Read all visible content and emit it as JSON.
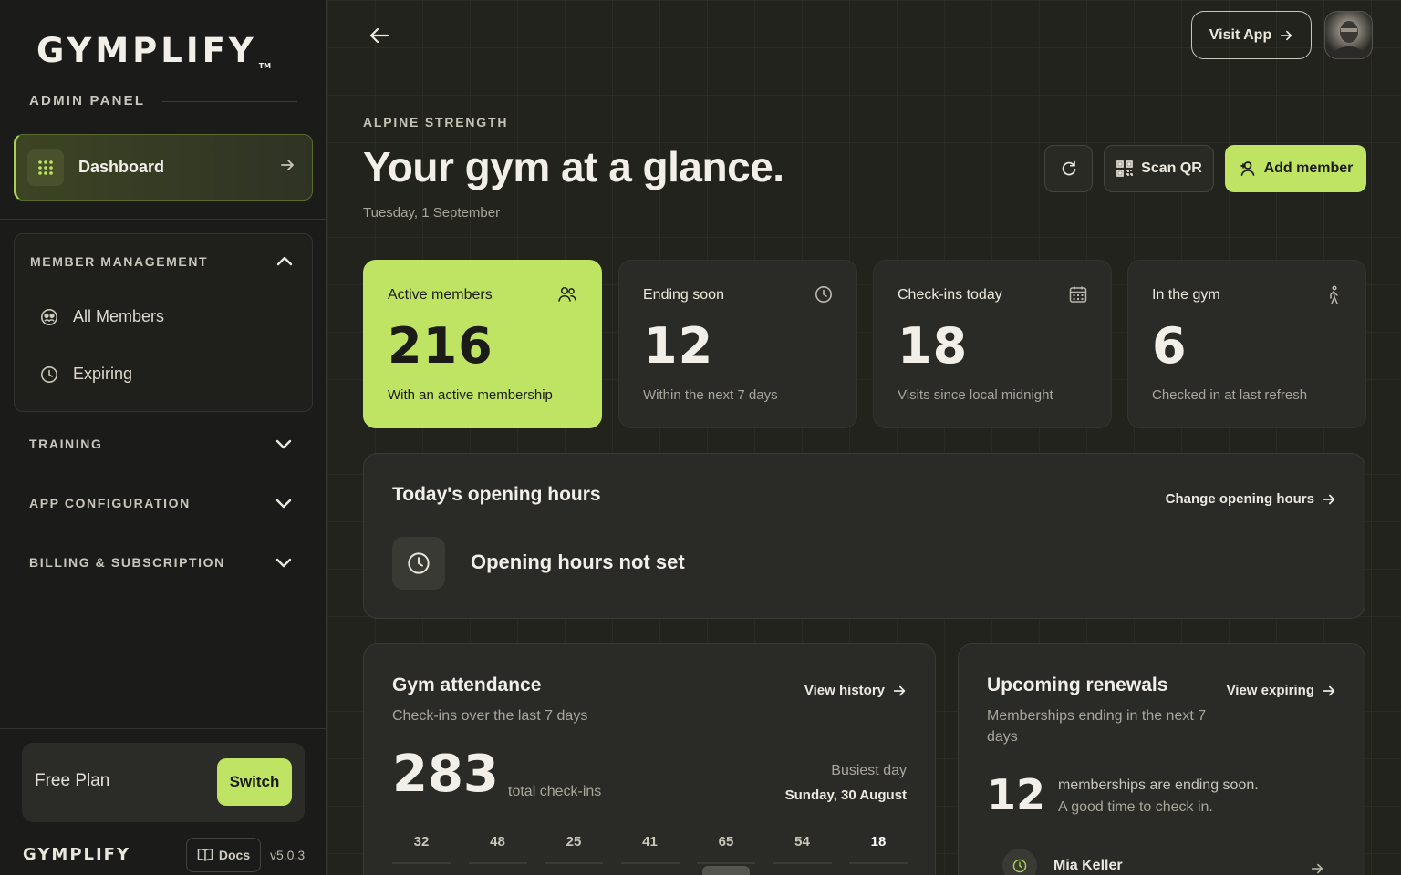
{
  "sidebar": {
    "brand": "GYMPLIFY",
    "brand_mark": "TM",
    "admin_label": "ADMIN PANEL",
    "dashboard_label": "Dashboard",
    "groups": [
      {
        "title": "MEMBER MANAGEMENT",
        "expanded": true,
        "items": [
          {
            "label": "All Members",
            "icon": "members-icon"
          },
          {
            "label": "Expiring",
            "icon": "clock-icon"
          }
        ]
      },
      {
        "title": "TRAINING",
        "expanded": false
      },
      {
        "title": "APP CONFIGURATION",
        "expanded": false
      },
      {
        "title": "BILLING & SUBSCRIPTION",
        "expanded": false
      }
    ],
    "plan": {
      "name": "Free Plan",
      "switch_label": "Switch"
    },
    "footer": {
      "brand": "GYMPLIFY",
      "docs_label": "Docs",
      "version": "v5.0.3"
    }
  },
  "header": {
    "visit_app_label": "Visit App"
  },
  "page": {
    "eyebrow": "ALPINE STRENGTH",
    "title": "Your gym at a glance.",
    "date": "Tuesday, 1 September",
    "actions": {
      "scan_label": "Scan QR",
      "add_label": "Add member"
    }
  },
  "stats": [
    {
      "label": "Active members",
      "value": "216",
      "sub": "With an active membership",
      "icon": "people-icon",
      "highlight": true
    },
    {
      "label": "Ending soon",
      "value": "12",
      "sub": "Within the next 7 days",
      "icon": "clock-icon"
    },
    {
      "label": "Check-ins today",
      "value": "18",
      "sub": "Visits since local midnight",
      "icon": "calendar-icon"
    },
    {
      "label": "In the gym",
      "value": "6",
      "sub": "Checked in at last refresh",
      "icon": "walking-icon"
    }
  ],
  "opening_hours": {
    "title": "Today's opening hours",
    "link": "Change opening hours",
    "status": "Opening hours not set"
  },
  "attendance": {
    "title": "Gym attendance",
    "link": "View history",
    "subtitle": "Check-ins over the last 7 days",
    "total": "283",
    "total_label": "total check-ins",
    "busiest_label": "Busiest day",
    "busiest_value": "Sunday, 30 August",
    "days": [
      32,
      48,
      25,
      41,
      65,
      54,
      18
    ],
    "peak_index": 4,
    "today_index": 6
  },
  "renewals": {
    "title": "Upcoming renewals",
    "link": "View expiring",
    "subtitle": "Memberships ending in the next 7 days",
    "count": "12",
    "message_line1": "memberships are ending soon.",
    "message_line2": "A good time to check in.",
    "first_member": "Mia Keller"
  },
  "colors": {
    "accent": "#bfe463",
    "background": "#1d1d19",
    "card": "#2a2a26"
  }
}
